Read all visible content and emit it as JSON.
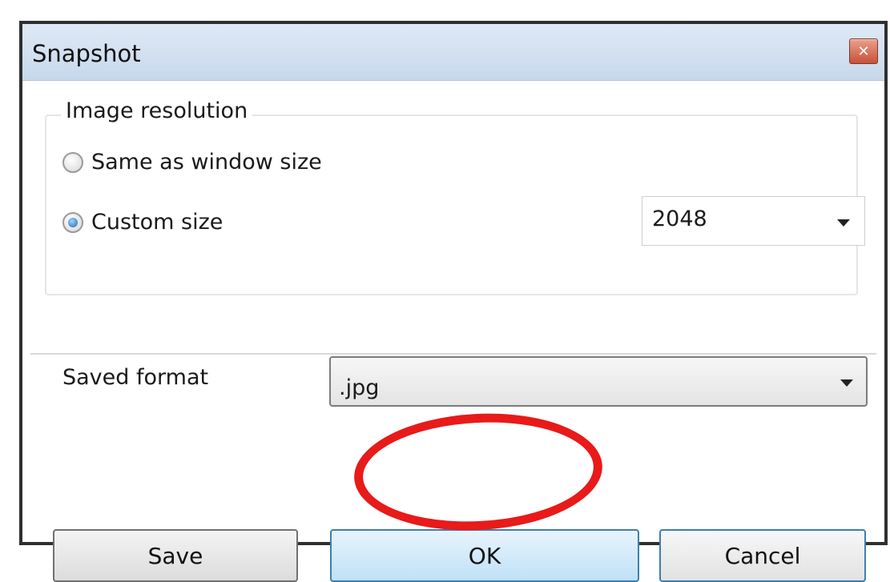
{
  "window": {
    "title": "Snapshot",
    "close_icon": "close-icon",
    "accent_close": "#c9503a"
  },
  "resolution": {
    "legend": "Image resolution",
    "options": [
      {
        "label": "Same as window size",
        "selected": false
      },
      {
        "label": "Custom size",
        "selected": true
      }
    ],
    "custom_size": {
      "value": "2048"
    }
  },
  "format": {
    "label": "Saved format",
    "value": ".jpg"
  },
  "buttons": {
    "save": "Save",
    "ok": "OK",
    "cancel": "Cancel"
  },
  "annotation": {
    "highlight_color": "#e81a1a",
    "highlight_target": "ok-button"
  }
}
